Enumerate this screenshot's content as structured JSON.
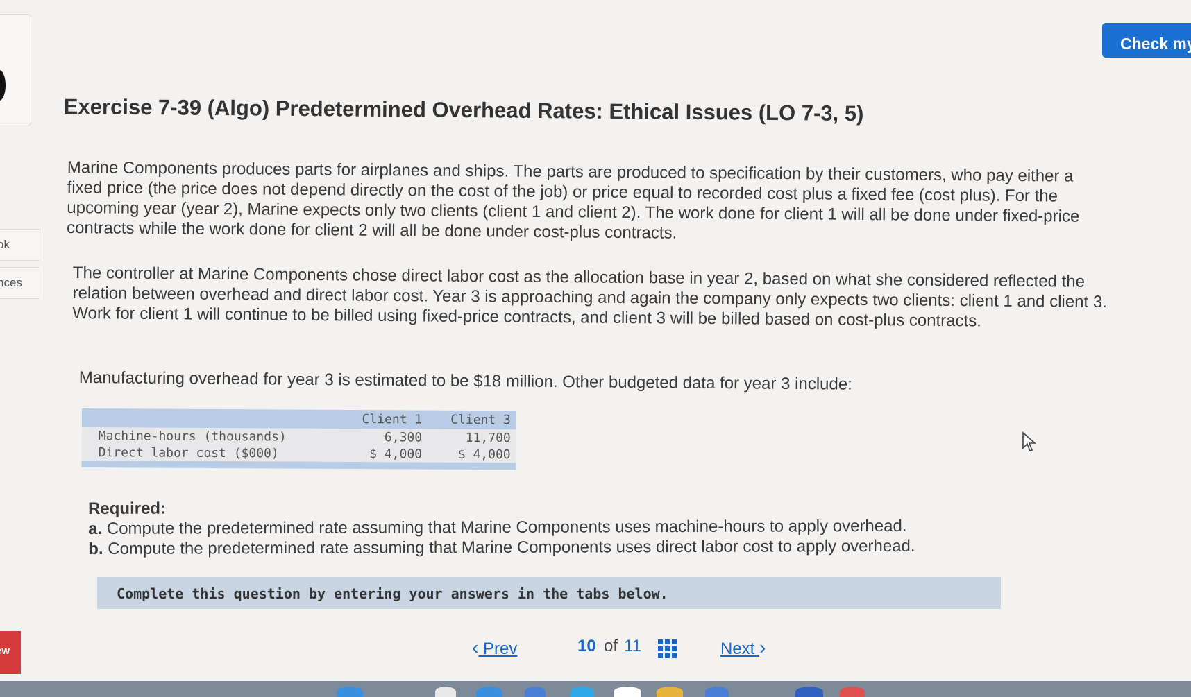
{
  "header": {
    "check_button_label": "Check my"
  },
  "side_tabs": [
    {
      "label": "ok"
    },
    {
      "label": "nces"
    }
  ],
  "side_badge": "ew",
  "exercise": {
    "title": "Exercise 7-39 (Algo) Predetermined Overhead Rates: Ethical Issues (LO 7-3, 5)",
    "paragraphs": [
      "Marine Components produces parts for airplanes and ships. The parts are produced to specification by their customers, who pay either a fixed price (the price does not depend directly on the cost of the job) or price equal to recorded cost plus a fixed fee (cost plus). For the upcoming year (year 2), Marine expects only two clients (client 1 and client 2). The work done for client 1 will all be done under fixed-price contracts while the work done for client 2 will all be done under cost-plus contracts.",
      "The controller at Marine Components chose direct labor cost as the allocation base in year 2, based on what she considered reflected the relation between overhead and direct labor cost. Year 3 is approaching and again the company only expects two clients: client 1 and client 3. Work for client 1 will continue to be billed using fixed-price contracts, and client 3 will be billed based on cost-plus contracts.",
      "Manufacturing overhead for year 3 is estimated to be $18 million. Other budgeted data for year 3 include:"
    ]
  },
  "budget_table": {
    "columns": [
      "",
      "Client 1",
      "Client 3"
    ],
    "rows": [
      {
        "label": "Machine-hours (thousands)",
        "client1": "6,300",
        "client3": "11,700"
      },
      {
        "label": "Direct labor cost ($000)",
        "client1": "$ 4,000",
        "client3": "$ 4,000"
      }
    ]
  },
  "required": {
    "heading": "Required:",
    "items": [
      {
        "letter": "a.",
        "text": "Compute the predetermined rate assuming that Marine Components uses machine-hours to apply overhead."
      },
      {
        "letter": "b.",
        "text": "Compute the predetermined rate assuming that Marine Components uses direct labor cost to apply overhead."
      }
    ]
  },
  "banner": "Complete this question by entering your answers in the tabs below.",
  "pagination": {
    "prev_label": "Prev",
    "next_label": "Next",
    "current": "10",
    "of_label": "of",
    "total": "11"
  },
  "icons": {
    "prev": "chevron-left-icon",
    "next": "chevron-right-icon",
    "grid": "grid-icon",
    "cursor": "mouse-cursor-icon"
  },
  "colors": {
    "accent": "#1a6fd1",
    "link": "#1a66c4",
    "table_header": "#b9cce6",
    "banner": "#cad5e3",
    "badge": "#d63b3b"
  }
}
